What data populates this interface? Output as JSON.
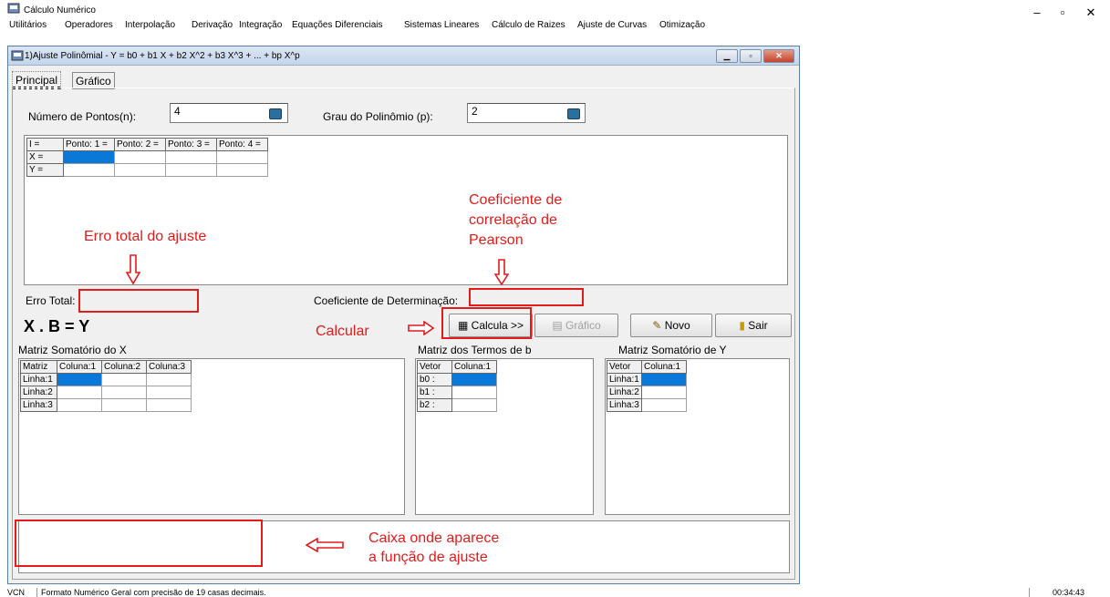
{
  "app": {
    "title": "Cálculo Numérico",
    "minimize": "–",
    "maximize": "▫",
    "close": "✕"
  },
  "menu": [
    "Utilitários",
    "Operadores",
    "Interpolação",
    "Derivação",
    "Integração",
    "Equações Diferenciais",
    "Sistemas Lineares",
    "Cálculo de Raizes",
    "Ajuste de Curvas",
    "Otimização"
  ],
  "child_window": {
    "title": "1)Ajuste Polinômial - Y = b0 + b1 X + b2 X^2 + b3 X^3 + ... + bp X^p",
    "tabs": [
      "Principal",
      "Gráfico"
    ]
  },
  "inputs": {
    "n_label": "Número de Pontos(n):",
    "n_value": "4",
    "p_label": "Grau do Polinômio (p):",
    "p_value": "2"
  },
  "points_grid": {
    "headers": [
      "I =",
      "Ponto: 1 =",
      "Ponto: 2 =",
      "Ponto: 3 =",
      "Ponto: 4 ="
    ],
    "rows": [
      "X =",
      "Y ="
    ]
  },
  "results": {
    "erro_label": "Erro Total:",
    "coef_label": "Coeficiente de Determinação:",
    "equation": "X . B = Y"
  },
  "buttons": {
    "calcula": "Calcula >>",
    "grafico": "Gráfico",
    "novo": "Novo",
    "sair": "Sair"
  },
  "matrices": {
    "x_title": "Matriz Somatório do X",
    "x_headers": [
      "Matriz",
      "Coluna:1",
      "Coluna:2",
      "Coluna:3"
    ],
    "x_rows": [
      "Linha:1",
      "Linha:2",
      "Linha:3"
    ],
    "b_title": "Matriz dos Termos de b",
    "b_headers": [
      "Vetor",
      "Coluna:1"
    ],
    "b_rows": [
      "b0 :",
      "b1 :",
      "b2 :"
    ],
    "y_title": "Matriz Somatório de Y",
    "y_headers": [
      "Vetor",
      "Coluna:1"
    ],
    "y_rows": [
      "Linha:1",
      "Linha:2",
      "Linha:3"
    ]
  },
  "annotations": {
    "erro_total": "Erro total do ajuste",
    "pearson_1": "Coeficiente de",
    "pearson_2": "correlação de",
    "pearson_3": "Pearson",
    "calcular": "Calcular",
    "caixa_1": "Caixa onde aparece",
    "caixa_2": "a função de ajuste",
    "color": "#e21b1b"
  },
  "status": {
    "mode": "VCN",
    "message": "Formato Numérico Geral com precisão de 19 casas decimais.",
    "time": "00:34:43"
  }
}
